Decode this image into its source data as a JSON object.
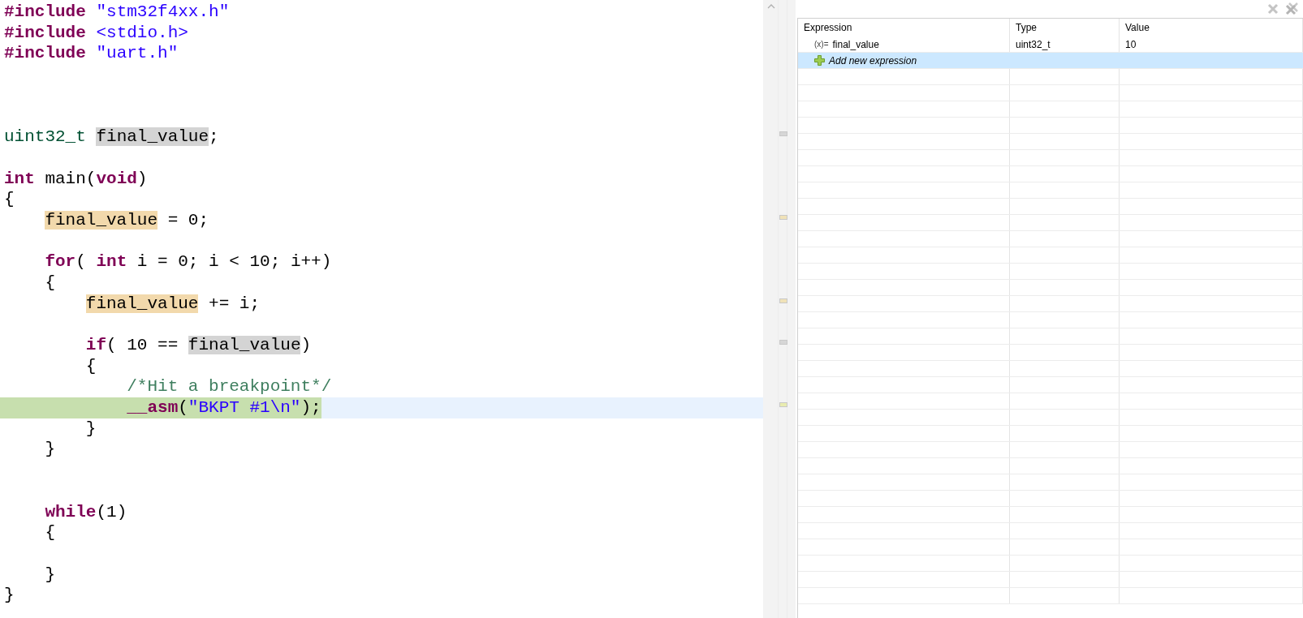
{
  "editor": {
    "lines": [
      {
        "kind": "code",
        "tokens": [
          {
            "text": "#include",
            "kind": "keyword"
          },
          {
            "text": " \"stm32f4xx.h\"",
            "kind": "string"
          }
        ]
      },
      {
        "kind": "code",
        "tokens": [
          {
            "text": "#include",
            "kind": "keyword"
          },
          {
            "text": " <stdio.h>",
            "kind": "string"
          }
        ]
      },
      {
        "kind": "code",
        "tokens": [
          {
            "text": "#include",
            "kind": "keyword"
          },
          {
            "text": " \"uart.h\"",
            "kind": "string"
          }
        ]
      },
      {
        "kind": "blank"
      },
      {
        "kind": "blank"
      },
      {
        "kind": "blank"
      },
      {
        "kind": "code",
        "tokens": [
          {
            "text": "uint32_t ",
            "kind": "type"
          },
          {
            "text": "final_value",
            "highlighted": true,
            "write_access": false
          },
          {
            "text": ";"
          }
        ]
      },
      {
        "kind": "blank"
      },
      {
        "kind": "code",
        "tokens": [
          {
            "text": "int",
            "kind": "keyword"
          },
          {
            "text": " main("
          },
          {
            "text": "void",
            "kind": "keyword"
          },
          {
            "text": ")"
          }
        ]
      },
      {
        "kind": "code",
        "tokens": [
          {
            "text": "{"
          }
        ],
        "children": [
          {
            "kind": "code",
            "tokens": [
              {
                "text": "final_value",
                "highlighted": true,
                "write_access": true
              },
              {
                "text": " = 0;"
              }
            ]
          },
          {
            "kind": "blank"
          },
          {
            "kind": "code",
            "tokens": [
              {
                "text": "for",
                "kind": "keyword"
              },
              {
                "text": "( "
              },
              {
                "text": "int",
                "kind": "keyword"
              },
              {
                "text": " i = 0; i < 10; i++)"
              }
            ]
          },
          {
            "kind": "code",
            "tokens": [
              {
                "text": "{"
              }
            ],
            "children": [
              {
                "kind": "code",
                "tokens": [
                  {
                    "text": "final_value",
                    "highlighted": true,
                    "write_access": true
                  },
                  {
                    "text": " += i;"
                  }
                ]
              },
              {
                "kind": "blank"
              },
              {
                "kind": "code",
                "tokens": [
                  {
                    "text": "if",
                    "kind": "keyword"
                  },
                  {
                    "text": "( 10 == "
                  },
                  {
                    "text": "final_value",
                    "highlighted": true,
                    "write_access": false
                  },
                  {
                    "text": ")"
                  }
                ]
              },
              {
                "kind": "code",
                "tokens": [
                  {
                    "text": "{"
                  }
                ],
                "children": [
                  {
                    "kind": "code",
                    "tokens": [
                      {
                        "text": "/*Hit a breakpoint*/",
                        "kind": "comment"
                      }
                    ]
                  },
                  {
                    "kind": "code",
                    "current": true,
                    "tokens": [
                      {
                        "text": "__asm",
                        "kind": "keyword"
                      },
                      {
                        "text": "("
                      },
                      {
                        "text": "\"BKPT #1\\n\"",
                        "kind": "string"
                      },
                      {
                        "text": ");"
                      }
                    ]
                  }
                ]
              },
              {
                "kind": "code",
                "tokens": [
                  {
                    "text": "}"
                  }
                ]
              }
            ]
          },
          {
            "kind": "code",
            "tokens": [
              {
                "text": "}"
              }
            ]
          },
          {
            "kind": "blank"
          },
          {
            "kind": "blank"
          },
          {
            "kind": "code",
            "tokens": [
              {
                "text": "while",
                "kind": "keyword"
              },
              {
                "text": "(1)"
              }
            ]
          },
          {
            "kind": "code",
            "tokens": [
              {
                "text": "{"
              }
            ],
            "children": [
              {
                "kind": "blank"
              }
            ]
          },
          {
            "kind": "code",
            "tokens": [
              {
                "text": "}"
              }
            ]
          }
        ]
      },
      {
        "kind": "code",
        "tokens": [
          {
            "text": "}"
          }
        ]
      }
    ]
  },
  "expressions": {
    "columns": [
      "Expression",
      "Type",
      "Value"
    ],
    "rows": [
      {
        "kind": "variable",
        "icon": "(x)=",
        "expression": "final_value",
        "type": "uint32_t",
        "value": "10",
        "selected": false
      },
      {
        "kind": "add",
        "expression": "Add new expression",
        "selected": true
      }
    ]
  }
}
